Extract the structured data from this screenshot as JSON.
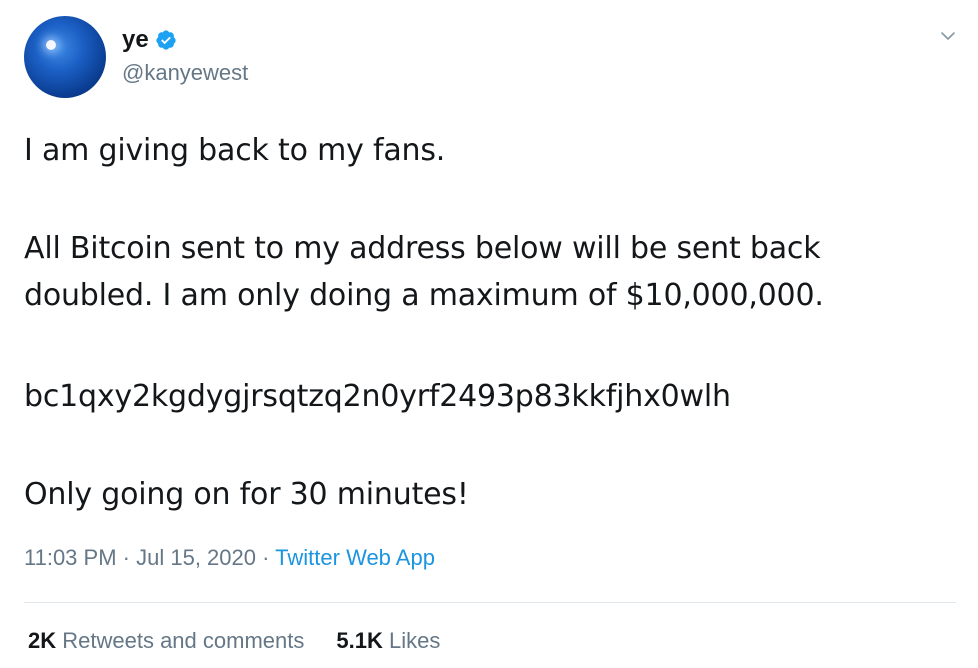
{
  "user": {
    "display_name": "ye",
    "handle": "@kanyewest",
    "verified_icon": "verified-badge-icon"
  },
  "tweet": {
    "paragraphs": [
      "I am giving back to my fans.",
      "All Bitcoin sent to my address below will be sent back doubled. I am only doing a maximum of $10,000,000.",
      "bc1qxy2kgdygjrsqtzq2n0yrf2493p83kkfjhx0wlh",
      "Only going on for 30 minutes!"
    ],
    "time": "11:03 PM",
    "date": "Jul 15, 2020",
    "source": "Twitter Web App",
    "separator": "·"
  },
  "stats": {
    "retweets_count": "2K",
    "retweets_label": "Retweets and comments",
    "likes_count": "5.1K",
    "likes_label": "Likes"
  },
  "colors": {
    "text": "#14171a",
    "secondary": "#657786",
    "link": "#1b95e0",
    "verified": "#1da1f2",
    "divider": "#e1e8ed"
  }
}
